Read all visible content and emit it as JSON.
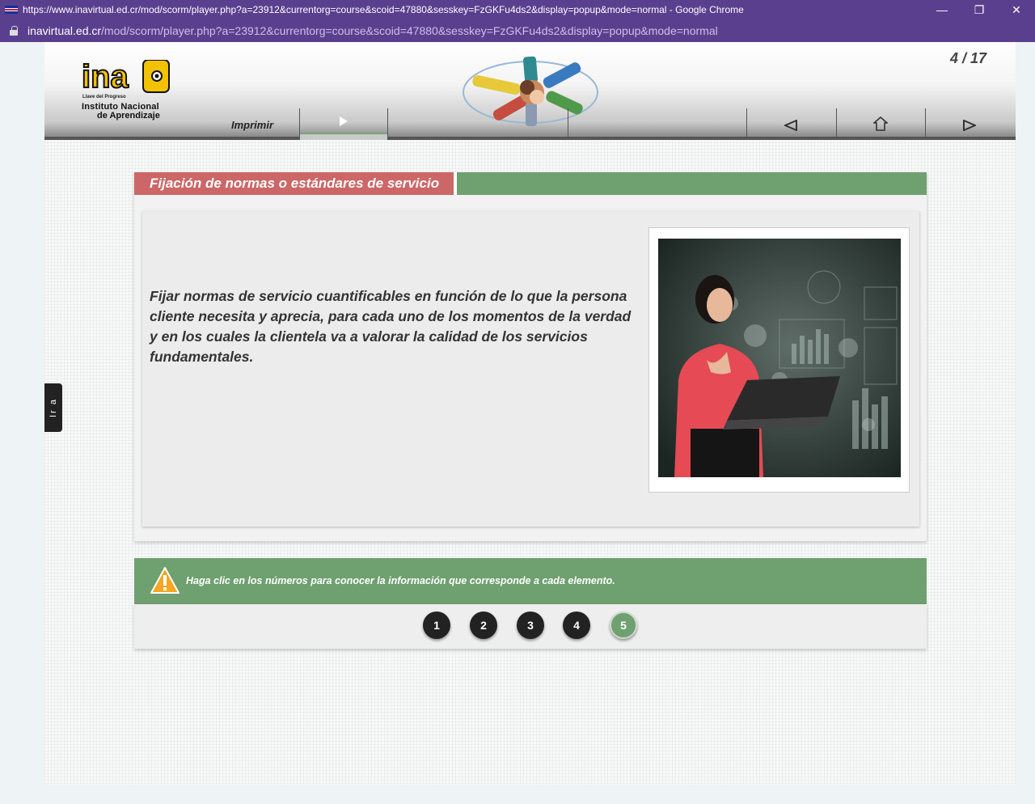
{
  "browser": {
    "window_title": "https://www.inavirtual.ed.cr/mod/scorm/player.php?a=23912&currentorg=course&scoid=47880&sesskey=FzGKFu4ds2&display=popup&mode=normal - Google Chrome",
    "url_domain": "inavirtual.ed.cr",
    "url_path": "/mod/scorm/player.php?a=23912&currentorg=course&scoid=47880&sesskey=FzGKFu4ds2&display=popup&mode=normal",
    "minimize_glyph": "—",
    "restore_glyph": "❐",
    "close_glyph": "✕",
    "accent_color": "#5b3f8f"
  },
  "header": {
    "logo": {
      "wordmark": "ina",
      "tagline": "Llave del Progreso",
      "name_line1": "Instituto Nacional",
      "name_line2": "de Aprendizaje"
    },
    "page_counter": "4 / 17",
    "print_label": "Imprimir",
    "icons": {
      "play": "play-icon",
      "prev": "back-arrow-icon",
      "home": "home-icon",
      "next": "forward-arrow-icon"
    }
  },
  "side_tab": {
    "label": "Ir a"
  },
  "card": {
    "title": "Fijación de normas o estándares de servicio",
    "body": "Fijar normas de servicio cuantificables en función de lo que la persona cliente necesita y aprecia, para cada uno de los momentos de la verdad y en los cuales la clientela va a valorar la calidad de los servicios fundamentales.",
    "title_color": "#cc6767",
    "bar_color": "#6fa070"
  },
  "instruction": {
    "text": "Haga clic en los números para conocer la información que corresponde a cada elemento.",
    "icon": "warning-icon"
  },
  "numbers": [
    {
      "label": "1",
      "active": false
    },
    {
      "label": "2",
      "active": false
    },
    {
      "label": "3",
      "active": false
    },
    {
      "label": "4",
      "active": false
    },
    {
      "label": "5",
      "active": true
    }
  ]
}
